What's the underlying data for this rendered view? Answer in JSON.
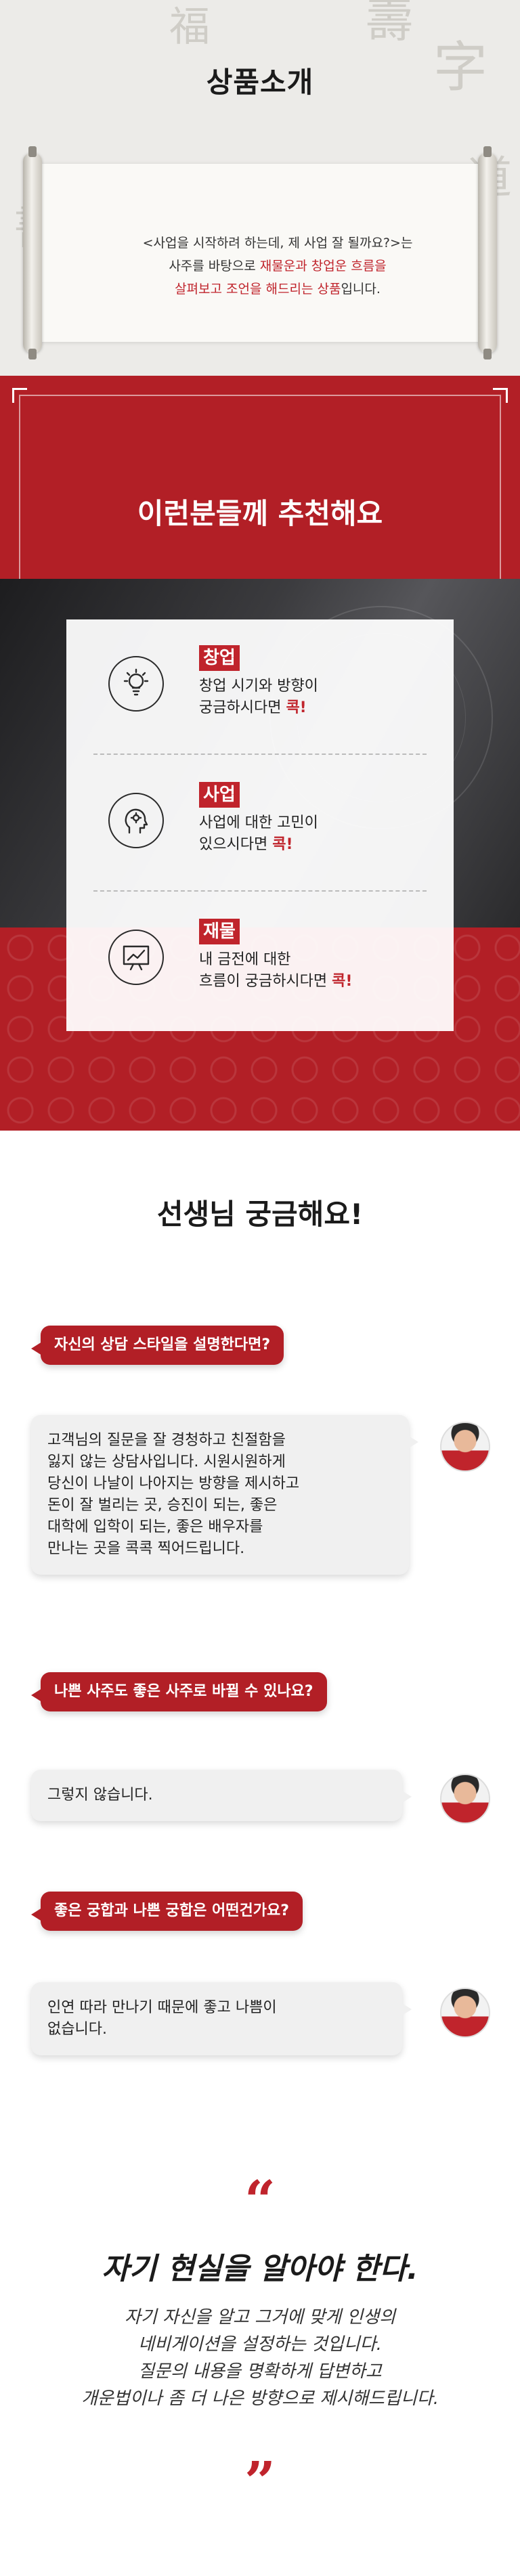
{
  "intro": {
    "title": "상품소개",
    "line1": "<사업을 시작하려 하는데, 제 사업 잘 될까요?>는",
    "line2_pre": "사주를 바탕으로 ",
    "line2_hl": "재물운과 창업운 흐름을",
    "line3_hl": "살펴보고 조언을 해드리는 상품",
    "line3_post": "입니다."
  },
  "recommend": {
    "title": "이런분들께 추천해요",
    "items": [
      {
        "tag": "창업",
        "line1": "창업 시기와 방향이",
        "line2_pre": "궁금하시다면 ",
        "line2_red": "콕!",
        "icon": "lightbulb-icon"
      },
      {
        "tag": "사업",
        "line1": "사업에 대한 고민이",
        "line2_pre": "있으시다면 ",
        "line2_red": "콕!",
        "icon": "head-thinking-icon"
      },
      {
        "tag": "재물",
        "line1": "내 금전에 대한",
        "line2_pre": "흐름이 궁금하시다면 ",
        "line2_red": "콕!",
        "icon": "chart-presentation-icon"
      }
    ]
  },
  "qa": {
    "title": "선생님 궁금해요!",
    "pairs": [
      {
        "question": "자신의 상담 스타일을 설명한다면?",
        "answer": [
          "고객님의 질문을 잘 경청하고 친절함을",
          "잃지 않는 상담사입니다. 시원시원하게",
          "당신이 나날이 나아지는 방향을 제시하고",
          "돈이 잘 벌리는 곳, 승진이 되는, 좋은",
          "대학에 입학이 되는, 좋은 배우자를",
          "만나는 곳을 콕콕 찍어드립니다."
        ]
      },
      {
        "question": "나쁜 사주도 좋은 사주로 바뀔 수 있나요?",
        "answer": [
          "그렇지 않습니다."
        ]
      },
      {
        "question": "좋은 궁합과 나쁜 궁합은 어떤건가요?",
        "answer": [
          "인연 따라 만나기 때문에 좋고 나쁨이",
          "없습니다."
        ]
      }
    ]
  },
  "quote": {
    "open_mark": "“",
    "close_mark": "”",
    "headline": "자기 현실을 알아야 한다.",
    "lines": [
      "자기 자신을 알고 그거에 맞게 인생의",
      "네비게이션을 설정하는 것입니다.",
      "질문의 내용을 명확하게 답변하고",
      "개운법이나 좀 더 나은  방향으로 제시해드립니다."
    ]
  },
  "colors": {
    "accent_red": "#b21f26",
    "highlight_red": "#c0242c",
    "paper": "#faf9f6"
  }
}
